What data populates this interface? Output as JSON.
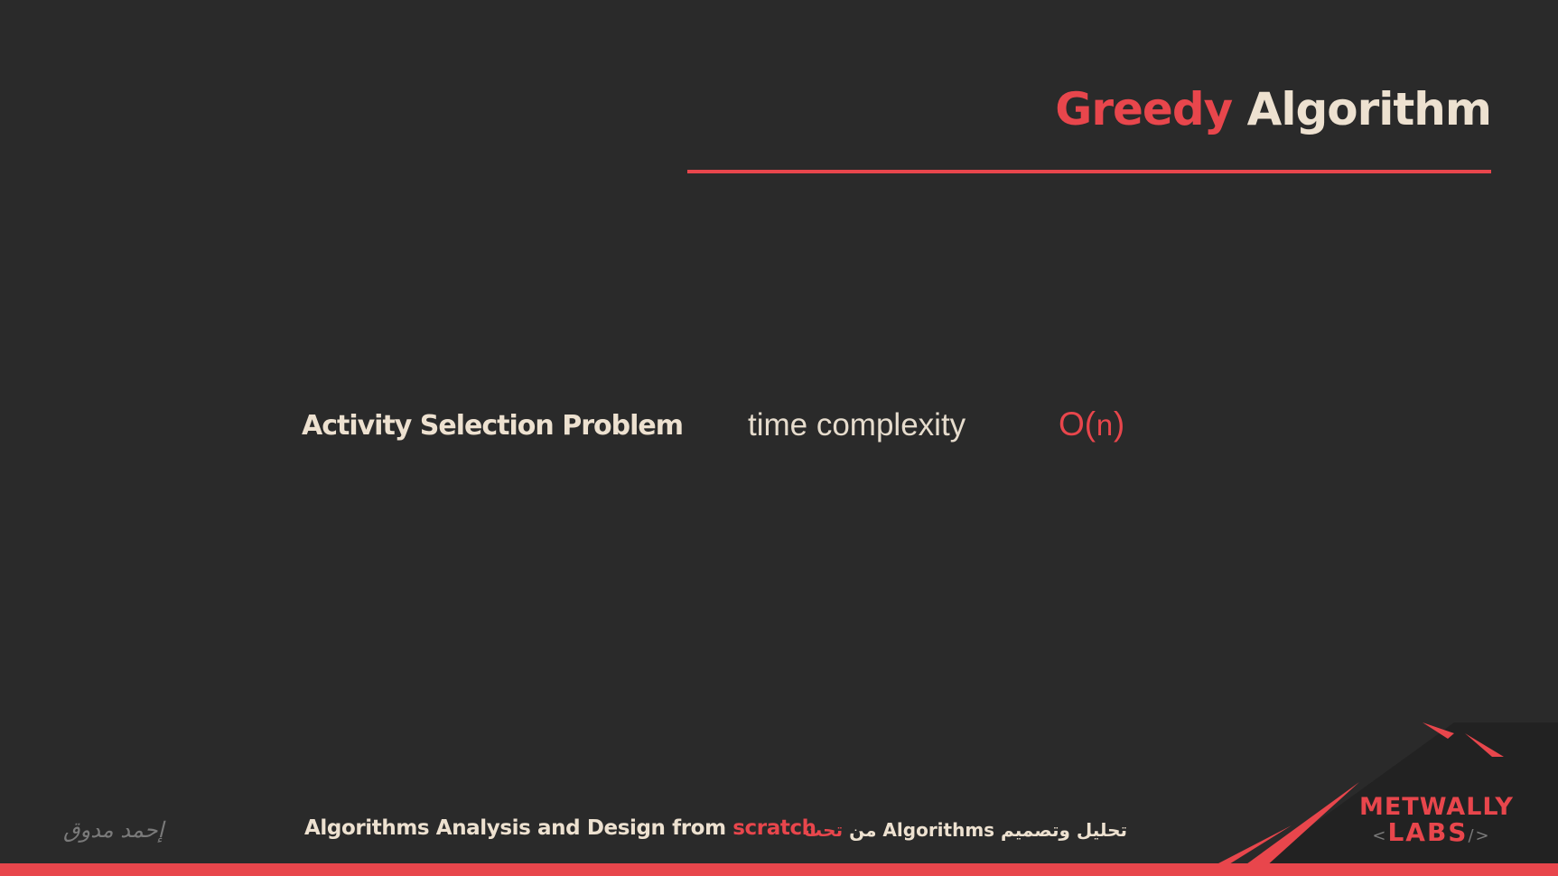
{
  "slide": {
    "title_part1": "Greedy",
    "title_part2": "Algorithm",
    "problem": "Activity Selection Problem",
    "complexity_label": "time complexity",
    "complexity_prefix": "O(",
    "complexity_var": "n",
    "complexity_suffix": ")"
  },
  "footer": {
    "signature": "إحمد مدوق",
    "course_prefix": "Algorithms Analysis and Design from",
    "course_accent": "scratch",
    "arabic_main": "تحليل وتصميم Algorithms من",
    "arabic_accent": "تحت"
  },
  "logo": {
    "line1": "METWALLY",
    "line2": "LABS",
    "bracket_left": "<",
    "bracket_right": "/>"
  },
  "colors": {
    "background": "#2a2a2a",
    "accent": "#e8464c",
    "text": "#ede1d0"
  }
}
